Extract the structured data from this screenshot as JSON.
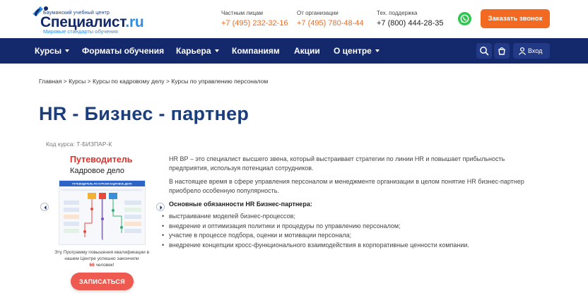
{
  "header": {
    "logo": {
      "top_text": "Бауманский учебный центр",
      "main_text": "Специалист",
      "domain_text": ".ru",
      "sub_text": "Мировые стандарты обучения"
    },
    "contacts": [
      {
        "label": "Частным лицам",
        "phone": "+7 (495) 232-32-16"
      },
      {
        "label": "От организации",
        "phone": "+7 (495) 780-48-44"
      },
      {
        "label": "Тех. поддержка",
        "phone": "+7 (800) 444-28-35"
      }
    ],
    "callback_label": "Заказать звонок"
  },
  "nav": {
    "items": [
      {
        "label": "Курсы"
      },
      {
        "label": "Форматы обучения"
      },
      {
        "label": "Карьера"
      },
      {
        "label": "Компаниям"
      },
      {
        "label": "Акции"
      },
      {
        "label": "О центре"
      }
    ],
    "login_label": "Вход"
  },
  "breadcrumb": {
    "items": [
      "Главная",
      "Курсы",
      "Курсы по кадровому делу",
      "Курсы по управлению персоналом"
    ],
    "separator": ">"
  },
  "page": {
    "title": "HR - Бизнес - партнер",
    "course_code": "Код курса: Т-БИЗПАР-К"
  },
  "guide": {
    "title": "Путеводитель",
    "subtitle": "Кадровое дело",
    "poster_heading": "ПУТЕВОДИТЕЛЬ ПО КУРСАМ КАДРОВОЕ ДЕЛО",
    "stat_prefix": "Эту Программу повышения квалификации в нашем Центре успешно закончили",
    "stat_count": "66",
    "stat_suffix": "человек!",
    "enroll_label": "ЗАПИСАТЬСЯ"
  },
  "description": {
    "paragraph_1": "HR BP – это специалист высшего звена, который выстраивает стратегии по линии HR и повышает прибыльность предприятия, используя потенциал сотрудников.",
    "paragraph_2": "В настоящее время в сфере управления персоналом и менеджменте организации в целом понятие HR бизнес-партнер приобрело особенную популярность.",
    "duties_title": "Основные обязанности HR Бизнес-партнера:",
    "duties": [
      "выстраивание моделей бизнес-процессов;",
      "внедрение и оптимизация политики и процедуры по управлению персоналом;",
      "участие в процессе подбора, оценки и мотивации персонала;",
      "внедрение концепции кросс-функционального взаимодействия в корпоративные ценности компании."
    ]
  },
  "colors": {
    "brand_dark": "#14296b",
    "accent_orange": "#f26a21",
    "title_blue": "#1a3d7c",
    "guide_red": "#e0312d",
    "whatsapp_green": "#2ec650"
  },
  "icons": [
    "logo-mark-icon",
    "whatsapp-icon",
    "search-icon",
    "cart-icon",
    "user-icon",
    "chevron-left-icon",
    "chevron-right-icon"
  ]
}
